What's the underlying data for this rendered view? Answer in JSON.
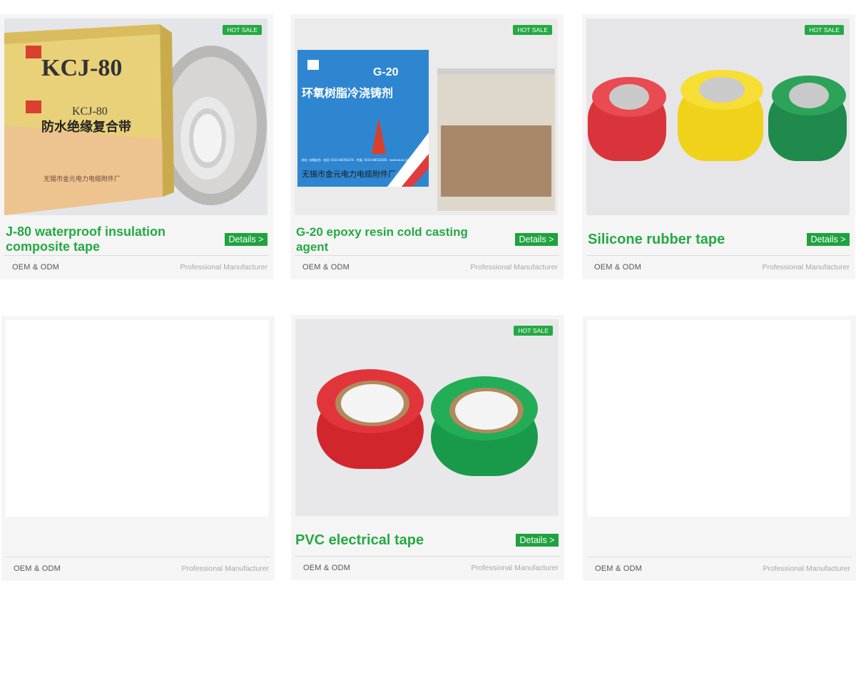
{
  "badges": {
    "hot_sale": "HOT SALE"
  },
  "buttons": {
    "details": "Details >"
  },
  "footer": {
    "left": "OEM & ODM",
    "right": "Professional Manufacturer"
  },
  "colors": {
    "accent_green": "#25a944",
    "card_bg": "#f5f5f5",
    "divider": "#dcdcdc"
  },
  "products": [
    {
      "title": "J-80 waterproof insulation composite tape",
      "image": {
        "box_brand": "KCJ-80",
        "box_model": "KCJ-80",
        "box_text": "防水绝缘复合带",
        "box_maker": "无锡市金元电力电缆附件厂"
      }
    },
    {
      "title": "G-20 epoxy resin cold casting agent",
      "image": {
        "box_model": "G-20",
        "box_text": "环氧树脂冷浇铸剂",
        "box_maker": "无锡市金元电力电缆附件厂",
        "box_contact": "地址: 安镇安西 · 电话: 0510-88784276 · 传真: 0510-88530306 · www.wuxi.jinyuan.cn"
      }
    },
    {
      "title": "Silicone rubber tape"
    },
    {
      "title": "PVC electrical tape"
    }
  ]
}
